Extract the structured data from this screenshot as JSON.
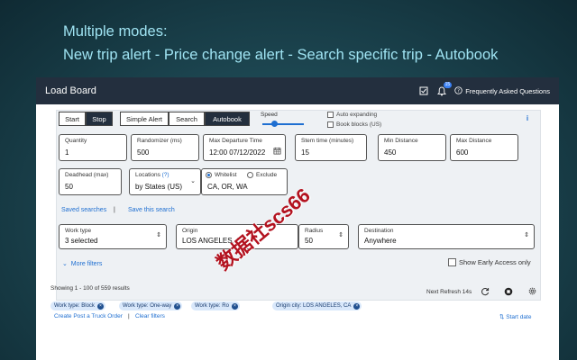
{
  "banner": {
    "line1": "Multiple modes:",
    "line2": "New trip alert - Price change alert - Search specific trip -  Autobook"
  },
  "app": {
    "title": "Load Board",
    "notification_count": "15",
    "faq_label": "Frequently Asked Questions"
  },
  "modes": {
    "start": "Start",
    "stop": "Stop",
    "simple_alert": "Simple Alert",
    "search": "Search",
    "autobook": "Autobook",
    "selected": "Autobook"
  },
  "speed": {
    "label": "Speed",
    "level": 0.3
  },
  "options": {
    "auto_expanding": "Auto expanding",
    "book_blocks": "Book blocks (US)"
  },
  "fields": {
    "quantity": {
      "label": "Quantity",
      "value": "1"
    },
    "randomizer": {
      "label": "Randomizer (ms)",
      "value": "500"
    },
    "max_departure": {
      "label": "Max Departure Time",
      "value": "12:00 07/12/2022"
    },
    "stem_time": {
      "label": "Stem time (minutes)",
      "value": "15"
    },
    "min_distance": {
      "label": "Min Distance",
      "value": "450"
    },
    "max_distance": {
      "label": "Max Distance",
      "value": "600"
    },
    "deadhead": {
      "label": "Deadhead (max)",
      "value": "50"
    },
    "locations": {
      "label": "Locations",
      "help": "(?)",
      "value": "by States (US)"
    },
    "whitelist": "Whitelist",
    "exclude": "Exclude",
    "states": "CA, OR, WA"
  },
  "links": {
    "saved_searches": "Saved searches",
    "divider": "|",
    "save_this_search": "Save this search"
  },
  "filters": {
    "work_type": {
      "label": "Work type",
      "value": "3 selected"
    },
    "origin": {
      "label": "Origin",
      "value": "LOS ANGELES, CA"
    },
    "radius": {
      "label": "Radius",
      "value": "50"
    },
    "destination": {
      "label": "Destination",
      "value": "Anywhere"
    },
    "more_filters": "More filters",
    "early_access": "Show Early Access only"
  },
  "results": {
    "showing": "Showing 1 - 100 of 559 results",
    "next_refresh": "Next Refresh 14s",
    "chips": [
      "Work type: Block",
      "Work type: One-way",
      "Work type: Ro",
      "Origin city: LOS ANGELES, CA"
    ],
    "create_post": "Create Post a Truck Order",
    "divider": "|",
    "clear_filters": "Clear filters",
    "start_date": "Start date"
  },
  "watermark": "数据社scs66",
  "colors": {
    "accent": "#1f6fd1",
    "topbar": "#232f3e",
    "banner_text": "#9fe3f2"
  }
}
